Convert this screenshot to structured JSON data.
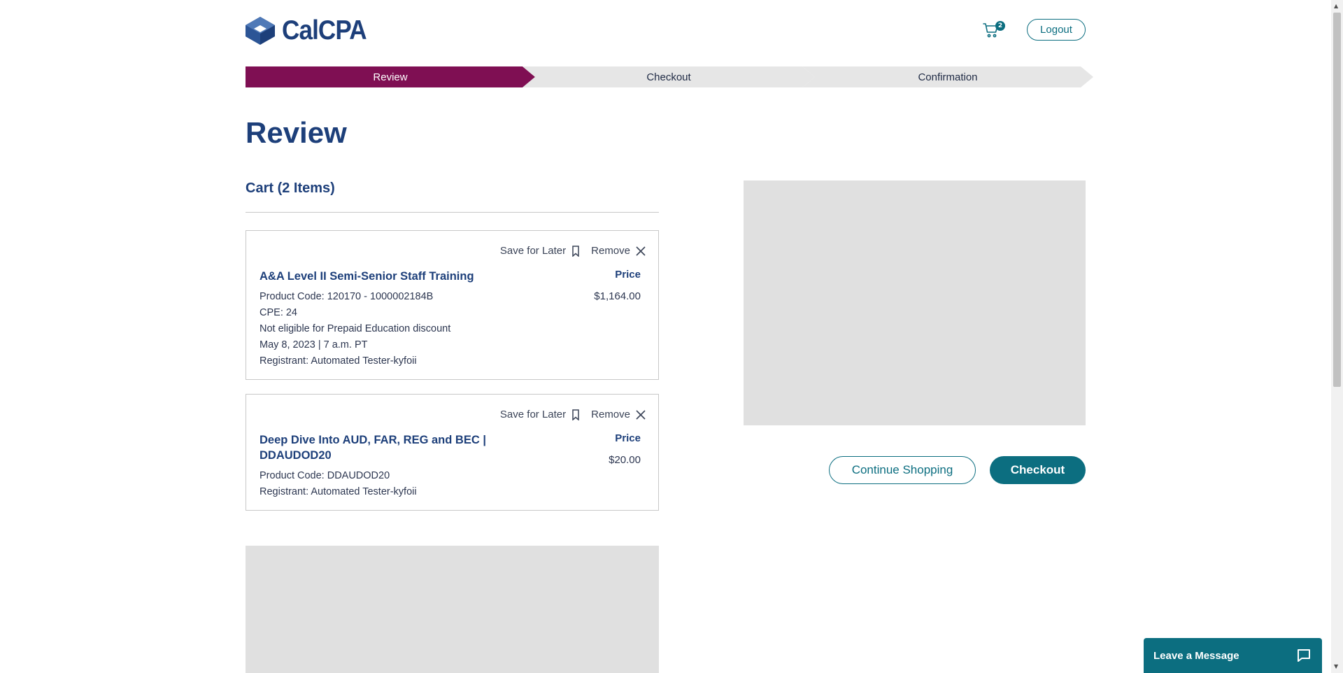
{
  "header": {
    "logo_text": "CalCPA",
    "cart_count": "2",
    "logout_label": "Logout"
  },
  "steps": [
    {
      "label": "Review"
    },
    {
      "label": "Checkout"
    },
    {
      "label": "Confirmation"
    }
  ],
  "page_title": "Review",
  "cart": {
    "heading": "Cart (2 Items)",
    "save_for_later_label": "Save for Later",
    "remove_label": "Remove",
    "price_label": "Price",
    "items": [
      {
        "title": "A&A Level II Semi-Senior Staff Training",
        "lines": [
          "Product Code: 120170 - 1000002184B",
          "CPE: 24",
          "Not eligible for Prepaid Education discount",
          "May 8, 2023 | 7 a.m. PT",
          "Registrant: Automated Tester-kyfoii"
        ],
        "price": "$1,164.00"
      },
      {
        "title": "Deep Dive Into AUD, FAR, REG and BEC | DDAUDOD20",
        "lines": [
          "Product Code: DDAUDOD20",
          "Registrant: Automated Tester-kyfoii"
        ],
        "price": "$20.00"
      }
    ]
  },
  "actions": {
    "continue_shopping": "Continue Shopping",
    "checkout": "Checkout"
  },
  "chat": {
    "label": "Leave a Message"
  },
  "colors": {
    "brand_blue": "#1d3f7a",
    "teal": "#0c6e80",
    "active_step": "#7f0f53",
    "inactive_step": "#e6e6e6",
    "placeholder": "#e0e0e0"
  }
}
